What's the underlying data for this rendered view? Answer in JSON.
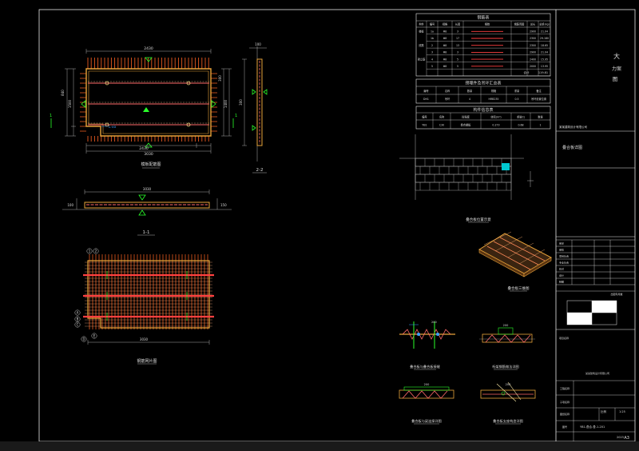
{
  "sheet": {
    "size_label": "A3"
  },
  "plan_top": {
    "top_dim": "2430",
    "bottom_dims": [
      "2430",
      "3030"
    ],
    "left_dims": [
      "840",
      "1500"
    ],
    "right_dims": [
      "300",
      "1400"
    ],
    "section_marks": [
      "1",
      "1"
    ],
    "caption": "模板配筋图",
    "rebar_note": "L-xx"
  },
  "section_2": {
    "caption": "2-2",
    "dims": [
      "100",
      "300"
    ]
  },
  "section_1": {
    "caption": "1-1",
    "dims": [
      "3030",
      "100",
      "150"
    ]
  },
  "plan_bottom": {
    "caption": "钢筋网片图",
    "dim": "3030",
    "axis_marks": [
      "1",
      "2",
      "A",
      "B",
      "C",
      "D",
      "E"
    ]
  },
  "tables": {
    "t1": {
      "title": "钢筋表",
      "headers": [
        "构件",
        "编号",
        "规格",
        "长度",
        "根数",
        "钢筋简图",
        "总长",
        "总重(kg)"
      ],
      "rows": [
        [
          "楼板",
          "1a",
          "Φ8",
          "3",
          "—",
          "2900",
          "21.04"
        ],
        [
          "",
          "1b",
          "Φ8",
          "17",
          "—",
          "2300",
          "29.180"
        ],
        [
          "底筋",
          "2",
          "Φ8",
          "13",
          "—",
          "2300",
          "18.65"
        ],
        [
          "",
          "3",
          "Φ8",
          "3",
          "—",
          "2900",
          "21.04"
        ],
        [
          "架立筋",
          "4",
          "Φ8",
          "5",
          "∧",
          "2400",
          "15.95"
        ],
        [
          "",
          "5",
          "Φ8",
          "5",
          "—",
          "2000",
          "13.95"
        ]
      ],
      "total_label": "合计",
      "total_value": "119.81"
    },
    "t2": {
      "title": "预埋件及吊环汇总表",
      "headers": [
        "编号",
        "名称",
        "数量",
        "规格",
        "重量",
        "备注"
      ],
      "row": [
        "DH1",
        "吊环",
        "4",
        "HRB235",
        "0.5",
        "吊环设置位置"
      ]
    },
    "t3": {
      "title": "构件信息表",
      "headers": [
        "编号",
        "名称",
        "砼强度",
        "体积(m³)",
        "重量(t)",
        "数量"
      ],
      "row": [
        "YB1",
        "C30",
        "叠合楼板",
        "0.273",
        "0.68",
        "1"
      ]
    }
  },
  "elevation": {
    "caption": "叠合板位置示意"
  },
  "iso": {
    "caption": "叠合板三维图"
  },
  "details": [
    {
      "caption": "叠合板与叠合板接缝",
      "dim": "200"
    },
    {
      "caption": "桁架钢筋做法详图",
      "dim": "200"
    },
    {
      "caption": "叠合板与梁连接详图",
      "dim": "200"
    },
    {
      "caption": "叠合板支座构造详图",
      "dim": "200"
    }
  ],
  "title_block": {
    "logo_text": [
      "大",
      "力案",
      "图"
    ],
    "company": "某某建筑设计有限公司",
    "project_label": "项目名称",
    "fields": [
      "审定",
      "审核",
      "项目负责",
      "专业负责",
      "校对",
      "设计",
      "制图"
    ],
    "stamp_label": "出图专用章",
    "drawing_title": "叠合板详图",
    "row_labels": [
      "工程名称",
      "子项名称",
      "图纸名称",
      "图号"
    ],
    "scale_label": "比例",
    "scale_value": "1:25",
    "drawing_no": "YB1-叠合-叠-1-201",
    "date": "2023"
  }
}
